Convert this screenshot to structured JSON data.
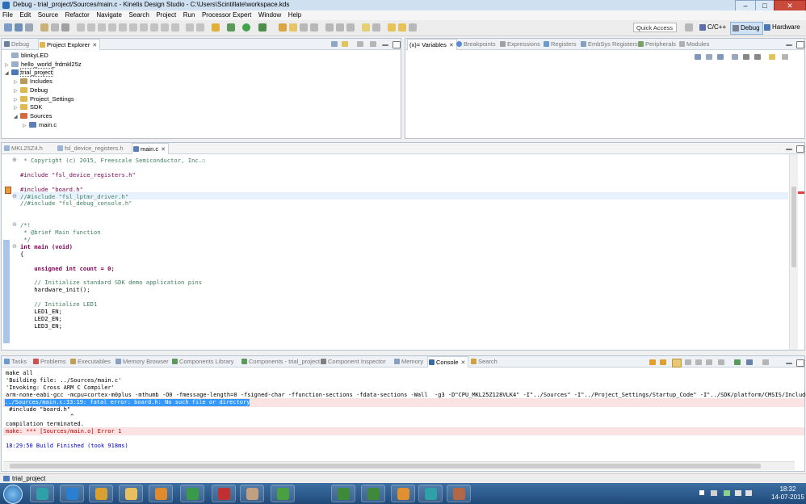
{
  "window": {
    "title": "Debug - trial_project/Sources/main.c - Kinetis Design Studio - C:\\Users\\Scintillate\\workspace.kds",
    "minimize": "–",
    "maximize": "□",
    "close": "✕"
  },
  "menu": [
    "File",
    "Edit",
    "Source",
    "Refactor",
    "Navigate",
    "Search",
    "Project",
    "Run",
    "Processor Expert",
    "Window",
    "Help"
  ],
  "toolbar": {
    "quick_access": "Quick Access",
    "perspectives": [
      "C/C++",
      "Debug",
      "Hardware"
    ]
  },
  "left_panel": {
    "tabs": [
      {
        "label": "Debug",
        "icon": "debug-icon"
      },
      {
        "label": "Project Explorer",
        "icon": "folder-icon"
      }
    ],
    "tree": [
      {
        "label": "blinkyLED",
        "depth": 0,
        "expander": ""
      },
      {
        "label": "hello_world_frdmkl25z",
        "depth": 0,
        "expander": "▷"
      },
      {
        "label": "trial_project",
        "depth": 0,
        "expander": "◢"
      },
      {
        "label": "Includes",
        "depth": 1,
        "expander": "▷"
      },
      {
        "label": "Debug",
        "depth": 1,
        "expander": "▷"
      },
      {
        "label": "Project_Settings",
        "depth": 1,
        "expander": "▷"
      },
      {
        "label": "SDK",
        "depth": 1,
        "expander": "▷"
      },
      {
        "label": "Sources",
        "depth": 1,
        "expander": "◢"
      },
      {
        "label": "main.c",
        "depth": 2,
        "expander": "▷"
      }
    ]
  },
  "right_panel": {
    "tabs": [
      {
        "label": "(x)= Variables",
        "icon": "variables-icon"
      },
      {
        "label": "Breakpoints",
        "icon": "breakpoint-icon"
      },
      {
        "label": "Expressions",
        "icon": "expressions-icon"
      },
      {
        "label": "Registers",
        "icon": "registers-icon"
      },
      {
        "label": "EmbSys Registers",
        "icon": "embsys-icon"
      },
      {
        "label": "Peripherals",
        "icon": "peripherals-icon"
      },
      {
        "label": "Modules",
        "icon": "modules-icon"
      }
    ]
  },
  "editor": {
    "tabs": [
      {
        "label": "MKL25Z4.h",
        "active": false
      },
      {
        "label": "fsl_device_registers.h",
        "active": false
      },
      {
        "label": "main.c",
        "active": true
      }
    ],
    "lines": [
      {
        "text": " * Copyright (c) 2015, Freescale Semiconductor, Inc.☐",
        "style": "cm",
        "fold": "⊕"
      },
      {
        "text": "",
        "style": ""
      },
      {
        "text": "#include \"fsl_device_registers.h\"",
        "style": "pp"
      },
      {
        "text": "",
        "style": ""
      },
      {
        "text": "#include \"board.h\"",
        "style": "pp",
        "marker": "error"
      },
      {
        "text": "//#include \"fsl_lptmr_driver.h\"",
        "style": "cm",
        "fold": "⊖",
        "highlight": true
      },
      {
        "text": "//#include \"fsl_debug_console.h\"",
        "style": "cm"
      },
      {
        "text": "",
        "style": ""
      },
      {
        "text": "",
        "style": ""
      },
      {
        "text": "/*!",
        "style": "cm",
        "fold": "⊖"
      },
      {
        "text": " * @brief Main function",
        "style": "cm"
      },
      {
        "text": " */",
        "style": "cm"
      },
      {
        "text": "int main (void)",
        "style": "fn",
        "fold": "⊖"
      },
      {
        "text": "{",
        "style": ""
      },
      {
        "text": "",
        "style": ""
      },
      {
        "text": "    unsigned int count = 0;",
        "style": "decl"
      },
      {
        "text": "",
        "style": ""
      },
      {
        "text": "    // Initialize standard SDK demo application pins",
        "style": "cm"
      },
      {
        "text": "    hardware_init();",
        "style": ""
      },
      {
        "text": "",
        "style": ""
      },
      {
        "text": "    // Initialize LED1",
        "style": "cm"
      },
      {
        "text": "    LED1_EN;",
        "style": ""
      },
      {
        "text": "    LED2_EN;",
        "style": ""
      },
      {
        "text": "    LED3_EN;",
        "style": ""
      }
    ]
  },
  "bottom_panel": {
    "tabs": [
      {
        "label": "Tasks",
        "active": false
      },
      {
        "label": "Problems",
        "active": false
      },
      {
        "label": "Executables",
        "active": false
      },
      {
        "label": "Memory Browser",
        "active": false
      },
      {
        "label": "Components Library",
        "active": false
      },
      {
        "label": "Components - trial_project",
        "active": false
      },
      {
        "label": "Component Inspector",
        "active": false
      },
      {
        "label": "Memory",
        "active": false
      },
      {
        "label": "Console",
        "active": true
      },
      {
        "label": "Search",
        "active": false
      }
    ],
    "console": [
      {
        "text": "make all",
        "style": ""
      },
      {
        "text": "'Building file: ../Sources/main.c'",
        "style": ""
      },
      {
        "text": "'Invoking: Cross ARM C Compiler'",
        "style": ""
      },
      {
        "text": "arm-none-eabi-gcc -mcpu=cortex-m0plus -mthumb -O0 -fmessage-length=0 -fsigned-char -ffunction-sections -fdata-sections -Wall  -g3 -D\"CPU_MKL25Z128VLK4\" -I\"../Sources\" -I\"../Project_Settings/Startup_Code\" -I\"../SDK/platform/CMSIS/Include",
        "style": ""
      },
      {
        "text": "../Sources/main.c:33:19: fatal error: board.h: No such file or directory",
        "style": "selected"
      },
      {
        "text": " #include \"board.h\"",
        "style": ""
      },
      {
        "text": "                   ^",
        "style": ""
      },
      {
        "text": "compilation terminated.",
        "style": ""
      },
      {
        "text": "make: *** [Sources/main.o] Error 1",
        "style": "err"
      },
      {
        "text": "",
        "style": ""
      },
      {
        "text": "18:29:50 Build Finished (took 918ms)",
        "style": "info"
      }
    ]
  },
  "status": {
    "selection": "trial_project"
  },
  "taskbar": {
    "apps": [
      "start-orb",
      "arduino-app",
      "internet-explorer",
      "chrome",
      "windows-explorer",
      "media-player",
      "green-app",
      "red-app",
      "settings-app",
      "green-document-app",
      "green-document-app-2",
      "excel-app",
      "orange-app",
      "arduino-app-2",
      "kinetis-design-studio"
    ],
    "time": "18:32",
    "date": "14-07-2015"
  }
}
